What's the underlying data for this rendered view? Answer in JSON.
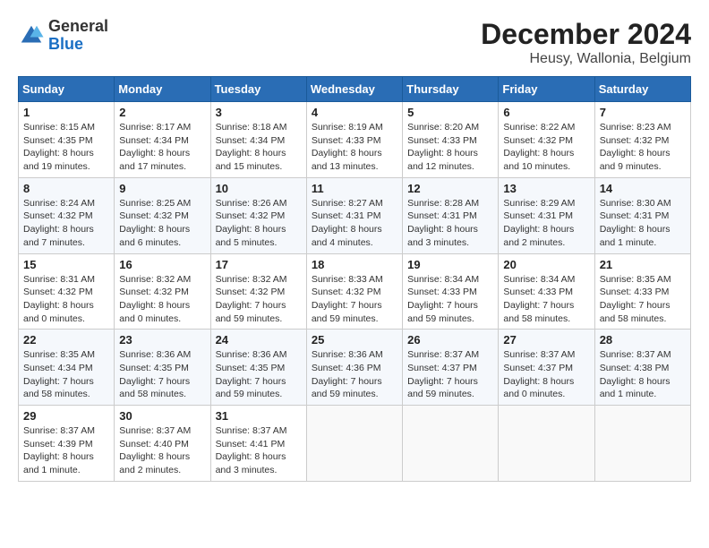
{
  "header": {
    "logo_general": "General",
    "logo_blue": "Blue",
    "title": "December 2024",
    "subtitle": "Heusy, Wallonia, Belgium"
  },
  "calendar": {
    "days_of_week": [
      "Sunday",
      "Monday",
      "Tuesday",
      "Wednesday",
      "Thursday",
      "Friday",
      "Saturday"
    ],
    "weeks": [
      [
        null,
        {
          "day": "2",
          "sunrise": "Sunrise: 8:17 AM",
          "sunset": "Sunset: 4:34 PM",
          "daylight": "Daylight: 8 hours and 17 minutes."
        },
        {
          "day": "3",
          "sunrise": "Sunrise: 8:18 AM",
          "sunset": "Sunset: 4:34 PM",
          "daylight": "Daylight: 8 hours and 15 minutes."
        },
        {
          "day": "4",
          "sunrise": "Sunrise: 8:19 AM",
          "sunset": "Sunset: 4:33 PM",
          "daylight": "Daylight: 8 hours and 13 minutes."
        },
        {
          "day": "5",
          "sunrise": "Sunrise: 8:20 AM",
          "sunset": "Sunset: 4:33 PM",
          "daylight": "Daylight: 8 hours and 12 minutes."
        },
        {
          "day": "6",
          "sunrise": "Sunrise: 8:22 AM",
          "sunset": "Sunset: 4:32 PM",
          "daylight": "Daylight: 8 hours and 10 minutes."
        },
        {
          "day": "7",
          "sunrise": "Sunrise: 8:23 AM",
          "sunset": "Sunset: 4:32 PM",
          "daylight": "Daylight: 8 hours and 9 minutes."
        }
      ],
      [
        {
          "day": "8",
          "sunrise": "Sunrise: 8:24 AM",
          "sunset": "Sunset: 4:32 PM",
          "daylight": "Daylight: 8 hours and 7 minutes."
        },
        {
          "day": "9",
          "sunrise": "Sunrise: 8:25 AM",
          "sunset": "Sunset: 4:32 PM",
          "daylight": "Daylight: 8 hours and 6 minutes."
        },
        {
          "day": "10",
          "sunrise": "Sunrise: 8:26 AM",
          "sunset": "Sunset: 4:32 PM",
          "daylight": "Daylight: 8 hours and 5 minutes."
        },
        {
          "day": "11",
          "sunrise": "Sunrise: 8:27 AM",
          "sunset": "Sunset: 4:31 PM",
          "daylight": "Daylight: 8 hours and 4 minutes."
        },
        {
          "day": "12",
          "sunrise": "Sunrise: 8:28 AM",
          "sunset": "Sunset: 4:31 PM",
          "daylight": "Daylight: 8 hours and 3 minutes."
        },
        {
          "day": "13",
          "sunrise": "Sunrise: 8:29 AM",
          "sunset": "Sunset: 4:31 PM",
          "daylight": "Daylight: 8 hours and 2 minutes."
        },
        {
          "day": "14",
          "sunrise": "Sunrise: 8:30 AM",
          "sunset": "Sunset: 4:31 PM",
          "daylight": "Daylight: 8 hours and 1 minute."
        }
      ],
      [
        {
          "day": "15",
          "sunrise": "Sunrise: 8:31 AM",
          "sunset": "Sunset: 4:32 PM",
          "daylight": "Daylight: 8 hours and 0 minutes."
        },
        {
          "day": "16",
          "sunrise": "Sunrise: 8:32 AM",
          "sunset": "Sunset: 4:32 PM",
          "daylight": "Daylight: 8 hours and 0 minutes."
        },
        {
          "day": "17",
          "sunrise": "Sunrise: 8:32 AM",
          "sunset": "Sunset: 4:32 PM",
          "daylight": "Daylight: 7 hours and 59 minutes."
        },
        {
          "day": "18",
          "sunrise": "Sunrise: 8:33 AM",
          "sunset": "Sunset: 4:32 PM",
          "daylight": "Daylight: 7 hours and 59 minutes."
        },
        {
          "day": "19",
          "sunrise": "Sunrise: 8:34 AM",
          "sunset": "Sunset: 4:33 PM",
          "daylight": "Daylight: 7 hours and 59 minutes."
        },
        {
          "day": "20",
          "sunrise": "Sunrise: 8:34 AM",
          "sunset": "Sunset: 4:33 PM",
          "daylight": "Daylight: 7 hours and 58 minutes."
        },
        {
          "day": "21",
          "sunrise": "Sunrise: 8:35 AM",
          "sunset": "Sunset: 4:33 PM",
          "daylight": "Daylight: 7 hours and 58 minutes."
        }
      ],
      [
        {
          "day": "22",
          "sunrise": "Sunrise: 8:35 AM",
          "sunset": "Sunset: 4:34 PM",
          "daylight": "Daylight: 7 hours and 58 minutes."
        },
        {
          "day": "23",
          "sunrise": "Sunrise: 8:36 AM",
          "sunset": "Sunset: 4:35 PM",
          "daylight": "Daylight: 7 hours and 58 minutes."
        },
        {
          "day": "24",
          "sunrise": "Sunrise: 8:36 AM",
          "sunset": "Sunset: 4:35 PM",
          "daylight": "Daylight: 7 hours and 59 minutes."
        },
        {
          "day": "25",
          "sunrise": "Sunrise: 8:36 AM",
          "sunset": "Sunset: 4:36 PM",
          "daylight": "Daylight: 7 hours and 59 minutes."
        },
        {
          "day": "26",
          "sunrise": "Sunrise: 8:37 AM",
          "sunset": "Sunset: 4:37 PM",
          "daylight": "Daylight: 7 hours and 59 minutes."
        },
        {
          "day": "27",
          "sunrise": "Sunrise: 8:37 AM",
          "sunset": "Sunset: 4:37 PM",
          "daylight": "Daylight: 8 hours and 0 minutes."
        },
        {
          "day": "28",
          "sunrise": "Sunrise: 8:37 AM",
          "sunset": "Sunset: 4:38 PM",
          "daylight": "Daylight: 8 hours and 1 minute."
        }
      ],
      [
        {
          "day": "29",
          "sunrise": "Sunrise: 8:37 AM",
          "sunset": "Sunset: 4:39 PM",
          "daylight": "Daylight: 8 hours and 1 minute."
        },
        {
          "day": "30",
          "sunrise": "Sunrise: 8:37 AM",
          "sunset": "Sunset: 4:40 PM",
          "daylight": "Daylight: 8 hours and 2 minutes."
        },
        {
          "day": "31",
          "sunrise": "Sunrise: 8:37 AM",
          "sunset": "Sunset: 4:41 PM",
          "daylight": "Daylight: 8 hours and 3 minutes."
        },
        null,
        null,
        null,
        null
      ]
    ],
    "week0_sunday": {
      "day": "1",
      "sunrise": "Sunrise: 8:15 AM",
      "sunset": "Sunset: 4:35 PM",
      "daylight": "Daylight: 8 hours and 19 minutes."
    }
  }
}
